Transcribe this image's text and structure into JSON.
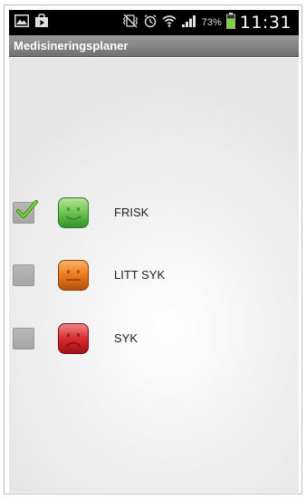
{
  "status_bar": {
    "left_icons": [
      "image-icon",
      "store-bag-icon"
    ],
    "right_icons": [
      "vibrate-muted-icon",
      "alarm-clock-icon",
      "wifi-icon",
      "signal-icon"
    ],
    "battery_percent": "73%",
    "battery_level": 0.73,
    "time": "11:31"
  },
  "app": {
    "title": "Medisineringsplaner"
  },
  "moods": [
    {
      "label": "FRISK",
      "checked": true,
      "face": "happy",
      "color": "#5cb84a"
    },
    {
      "label": "LITT SYK",
      "checked": false,
      "face": "neutral",
      "color": "#e8751a"
    },
    {
      "label": "SYK",
      "checked": false,
      "face": "sad",
      "color": "#d6262a"
    }
  ],
  "colors": {
    "checkmark": "#6fbf2a",
    "title_bar": "#828282",
    "battery": "#7ed23c"
  }
}
